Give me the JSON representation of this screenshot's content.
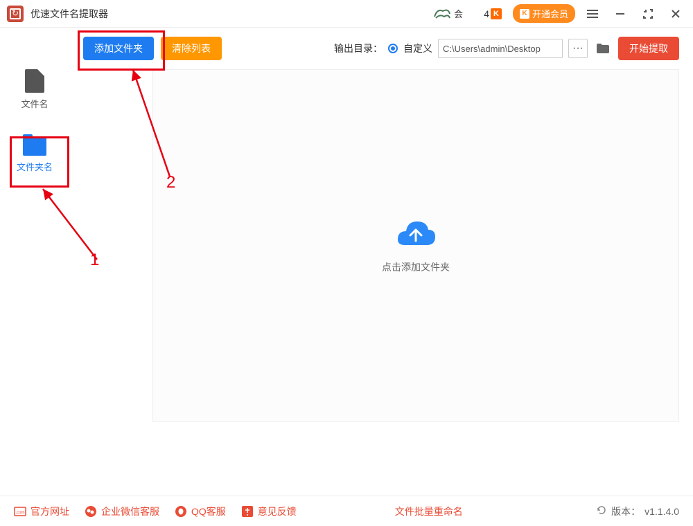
{
  "titlebar": {
    "title": "优速文件名提取器",
    "user_label": "会",
    "vip_count": "4",
    "vip_badge": "K",
    "vip_button": "开通会员"
  },
  "toolbar": {
    "add_folder": "添加文件夹",
    "clear_list": "清除列表",
    "output_label": "输出目录：",
    "custom_label": "自定义",
    "path_value": "C:\\Users\\admin\\Desktop",
    "dots": "···",
    "start_extract": "开始提取"
  },
  "sidebar": {
    "items": [
      {
        "label": "文件名"
      },
      {
        "label": "文件夹名"
      }
    ]
  },
  "dropzone": {
    "text": "点击添加文件夹"
  },
  "footer": {
    "official_site": "官方网址",
    "wechat_support": "企业微信客服",
    "qq_support": "QQ客服",
    "feedback": "意见反馈",
    "batch_rename": "文件批量重命名",
    "version_label": "版本：",
    "version": "v1.1.4.0"
  },
  "annotations": {
    "num1": "1",
    "num2": "2"
  }
}
